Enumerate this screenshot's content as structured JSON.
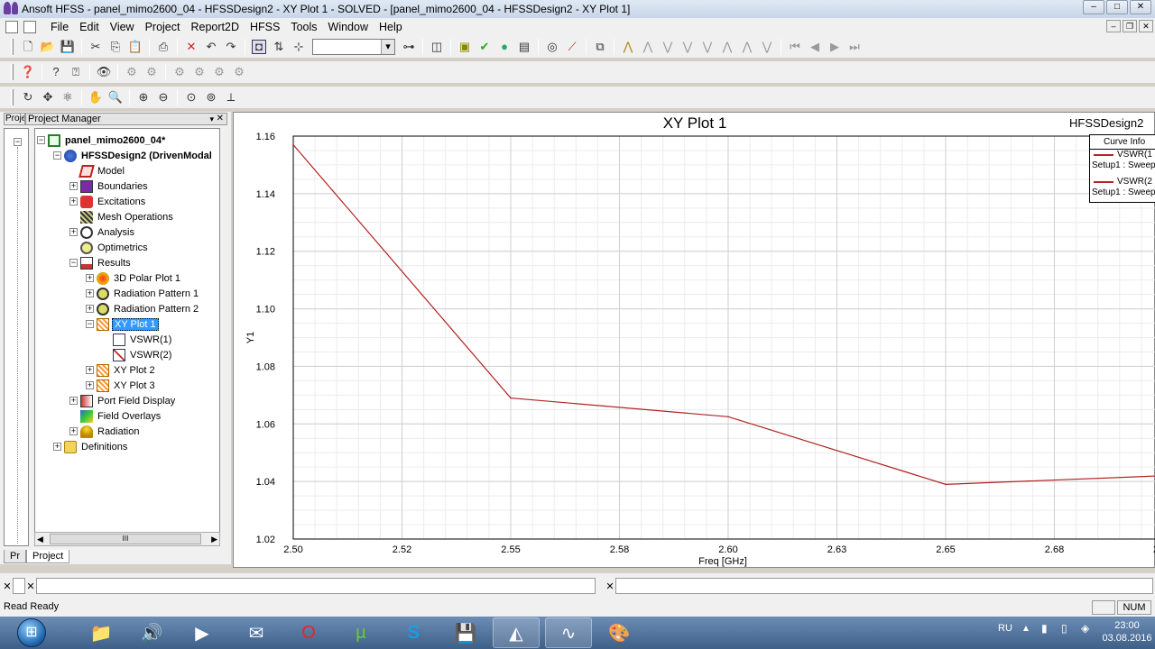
{
  "window": {
    "title": "Ansoft HFSS - panel_mimo2600_04 - HFSSDesign2 - XY Plot 1 - SOLVED - [panel_mimo2600_04 - HFSSDesign2 - XY Plot 1]",
    "min_glyph": "–",
    "max_glyph": "□",
    "close_glyph": "✕"
  },
  "menu": [
    "File",
    "Edit",
    "View",
    "Project",
    "Report2D",
    "HFSS",
    "Tools",
    "Window",
    "Help"
  ],
  "project_manager": {
    "tab_stub": "Proje",
    "title": "Project Manager",
    "pin": "▾",
    "close": "✕",
    "tabs": [
      "Pr",
      "Project"
    ],
    "scroll_thumb": "III",
    "tree": [
      {
        "label": "panel_mimo2600_04*",
        "icon": "project-icon"
      },
      {
        "label": "HFSSDesign2 (DrivenModal",
        "icon": "design-icon"
      },
      {
        "label": "Model",
        "icon": "model-icon"
      },
      {
        "label": "Boundaries",
        "icon": "boundaries-icon"
      },
      {
        "label": "Excitations",
        "icon": "excitations-icon"
      },
      {
        "label": "Mesh Operations",
        "icon": "mesh-icon"
      },
      {
        "label": "Analysis",
        "icon": "analysis-icon"
      },
      {
        "label": "Optimetrics",
        "icon": "optimetrics-icon"
      },
      {
        "label": "Results",
        "icon": "results-icon"
      },
      {
        "label": "3D Polar Plot 1",
        "icon": "polar-plot-icon"
      },
      {
        "label": "Radiation Pattern 1",
        "icon": "radiation-pattern-icon"
      },
      {
        "label": "Radiation Pattern 2",
        "icon": "radiation-pattern-icon"
      },
      {
        "label": "XY Plot 1",
        "icon": "xy-plot-icon"
      },
      {
        "label": "VSWR(1)",
        "icon": "trace-icon"
      },
      {
        "label": "VSWR(2)",
        "icon": "trace-icon"
      },
      {
        "label": "XY Plot 2",
        "icon": "xy-plot-icon"
      },
      {
        "label": "XY Plot 3",
        "icon": "xy-plot-icon"
      },
      {
        "label": "Port Field Display",
        "icon": "port-field-icon"
      },
      {
        "label": "Field Overlays",
        "icon": "field-overlays-icon"
      },
      {
        "label": "Radiation",
        "icon": "radiation-icon"
      },
      {
        "label": "Definitions",
        "icon": "folder-icon"
      }
    ]
  },
  "plot": {
    "design_name": "HFSSDesign2",
    "curve_info": {
      "header": "Curve Info",
      "entries": [
        {
          "name": "VSWR(1",
          "sub": "Setup1 : Sweep"
        },
        {
          "name": "VSWR(2",
          "sub": "Setup1 : Sweep"
        }
      ]
    }
  },
  "chart_data": {
    "type": "line",
    "title": "XY Plot 1",
    "xlabel": "Freq [GHz]",
    "ylabel": "Y1",
    "xlim": [
      2.5,
      2.7
    ],
    "ylim": [
      1.02,
      1.16
    ],
    "x_ticks": [
      "2.50",
      "2.52",
      "2.55",
      "2.58",
      "2.60",
      "2.63",
      "2.65",
      "2.68",
      "2"
    ],
    "y_ticks": [
      "1.16",
      "1.14",
      "1.12",
      "1.10",
      "1.08",
      "1.06",
      "1.04",
      "1.02"
    ],
    "grid": true,
    "legend_position": "top-right",
    "series": [
      {
        "name": "VSWR(1)",
        "color": "#b22222",
        "x": [
          2.5,
          2.55,
          2.6,
          2.65,
          2.7
        ],
        "y": [
          1.157,
          1.069,
          1.0625,
          1.039,
          1.042
        ]
      }
    ]
  },
  "status": {
    "text": "Read Ready",
    "num": "NUM"
  },
  "taskbar": {
    "language": "RU",
    "time": "23:00",
    "date": "03.08.2016"
  }
}
